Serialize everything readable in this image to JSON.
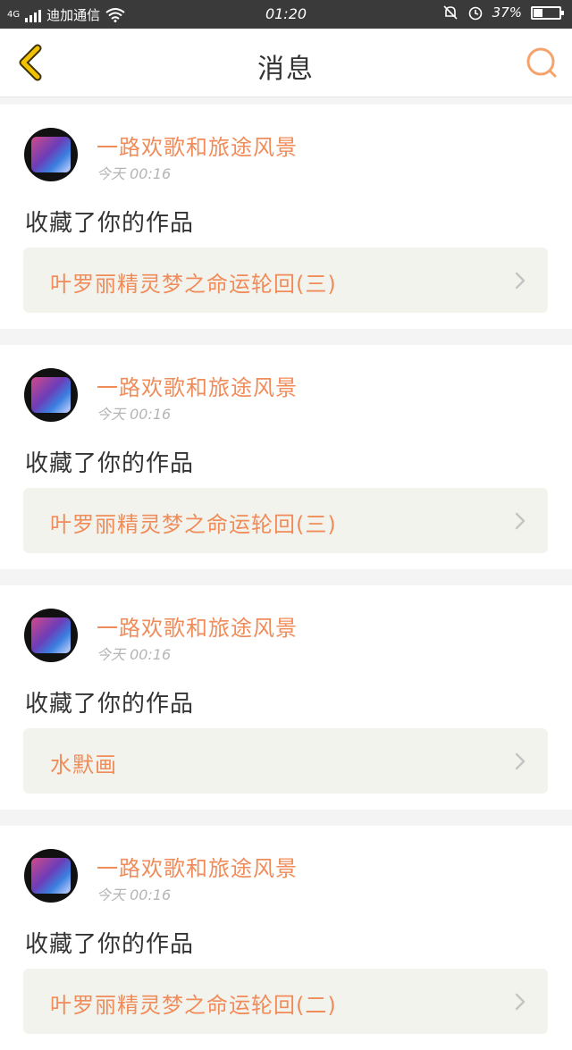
{
  "status": {
    "network": "4G",
    "carrier": "迪加通信",
    "time": "01:20",
    "battery": "37%",
    "battery_level": 0.37
  },
  "nav": {
    "title": "消息"
  },
  "messages": [
    {
      "user": "一路欢歌和旅途风景",
      "time": "今天 00:16",
      "action": "收藏了你的作品",
      "work": "叶罗丽精灵梦之命运轮回(三)"
    },
    {
      "user": "一路欢歌和旅途风景",
      "time": "今天 00:16",
      "action": "收藏了你的作品",
      "work": "叶罗丽精灵梦之命运轮回(三)"
    },
    {
      "user": "一路欢歌和旅途风景",
      "time": "今天 00:16",
      "action": "收藏了你的作品",
      "work": "水默画"
    },
    {
      "user": "一路欢歌和旅途风景",
      "time": "今天 00:16",
      "action": "收藏了你的作品",
      "work": "叶罗丽精灵梦之命运轮回(二)"
    }
  ],
  "colors": {
    "accent": "#f08c5a",
    "back_icon": "#f2c200",
    "status_bar": "#3a3a3a"
  },
  "icons": [
    "back-arrow-icon",
    "search-icon",
    "chevron-right-icon",
    "wifi-icon",
    "mute-bell-icon",
    "alarm-icon",
    "battery-icon",
    "signal-icon"
  ]
}
